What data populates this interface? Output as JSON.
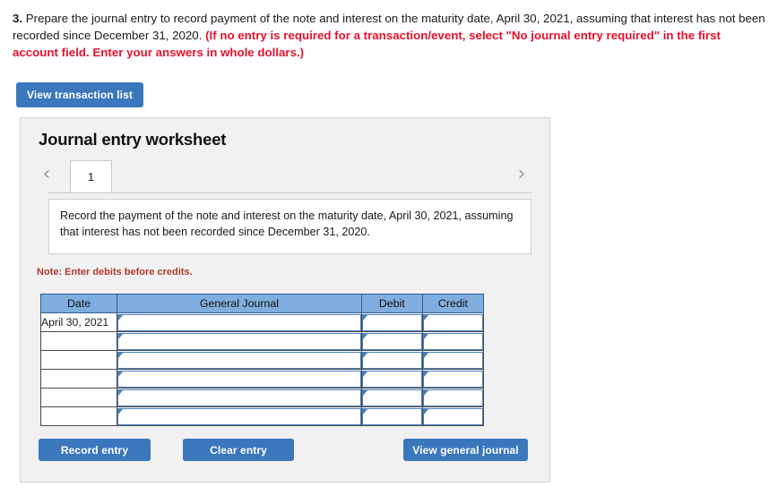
{
  "question": {
    "number": "3.",
    "body": " Prepare the journal entry to record payment of the note and interest on the maturity date, April 30, 2021, assuming that interest has not been recorded since December 31, 2020. ",
    "red_instruction": "(If no entry is required for a transaction/event, select \"No journal entry required\" in the first account field. Enter your answers in whole dollars.)"
  },
  "toolbar": {
    "view_transaction_list_label": "View transaction list"
  },
  "worksheet": {
    "title": "Journal entry worksheet",
    "tabs": [
      {
        "label": "1",
        "active": true
      }
    ],
    "prev_icon": "‹",
    "next_icon": "›",
    "description": "Record the payment of the note and interest on the maturity date, April 30, 2021, assuming that interest has not been recorded since December 31, 2020.",
    "note": "Note: Enter debits before credits."
  },
  "table": {
    "headers": [
      "Date",
      "General Journal",
      "Debit",
      "Credit"
    ],
    "rows": [
      {
        "date": "April 30, 2021",
        "general_journal": "",
        "debit": "",
        "credit": ""
      },
      {
        "date": "",
        "general_journal": "",
        "debit": "",
        "credit": ""
      },
      {
        "date": "",
        "general_journal": "",
        "debit": "",
        "credit": ""
      },
      {
        "date": "",
        "general_journal": "",
        "debit": "",
        "credit": ""
      },
      {
        "date": "",
        "general_journal": "",
        "debit": "",
        "credit": ""
      },
      {
        "date": "",
        "general_journal": "",
        "debit": "",
        "credit": ""
      }
    ]
  },
  "footer": {
    "record_entry_label": "Record entry",
    "clear_entry_label": "Clear entry",
    "view_general_journal_label": "View general journal"
  },
  "colors": {
    "button_blue": "#3a77bd",
    "header_blue": "#7fadde",
    "instruction_red": "#e8112d",
    "note_red": "#b03a2e",
    "panel_gray": "#f1f1f1"
  }
}
